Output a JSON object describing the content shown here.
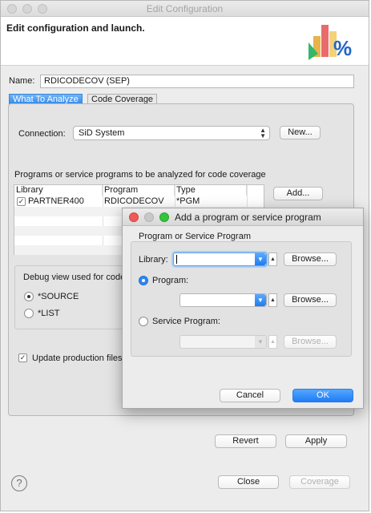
{
  "window": {
    "title": "Edit Configuration"
  },
  "header": {
    "title": "Edit configuration and launch."
  },
  "name_field": {
    "label": "Name:",
    "value": "RDICODECOV (SEP)"
  },
  "tabs": [
    {
      "label": "What To Analyze",
      "active": true
    },
    {
      "label": "Code Coverage",
      "active": false
    }
  ],
  "connection": {
    "label": "Connection:",
    "selected": "SiD System",
    "new_button": "New..."
  },
  "programs": {
    "label": "Programs or service programs to be analyzed for code coverage",
    "columns": [
      "Library",
      "Program",
      "Type"
    ],
    "rows": [
      {
        "checked": true,
        "library": "PARTNER400",
        "program": "RDICODECOV",
        "type": "*PGM"
      }
    ],
    "add_button": "Add..."
  },
  "debug_view": {
    "label": "Debug view used for code",
    "options": [
      {
        "label": "*SOURCE",
        "selected": true
      },
      {
        "label": "*LIST",
        "selected": false
      }
    ]
  },
  "update_production": {
    "label": "Update production files",
    "checked": true
  },
  "footer": {
    "revert": "Revert",
    "apply": "Apply",
    "close": "Close",
    "coverage": "Coverage"
  },
  "dialog": {
    "title": "Add a program or service program",
    "group_label": "Program or Service Program",
    "library_label": "Library:",
    "library_value": "",
    "program_radio": "Program:",
    "program_value": "",
    "service_radio": "Service Program:",
    "service_value": "",
    "browse": "Browse...",
    "cancel": "Cancel",
    "ok": "OK"
  },
  "help_icon": "?",
  "colors": {
    "accent": "#2b86f1",
    "close_dot": "#ee5d55",
    "min_dot": "#c8c8c8",
    "zoom_dot": "#35c33b"
  }
}
